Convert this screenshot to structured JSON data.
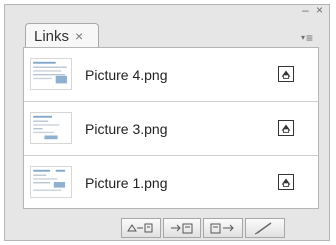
{
  "panel": {
    "tab": {
      "label": "Links",
      "close_glyph": "×"
    },
    "window_controls": {
      "minimize": "–",
      "close": "×"
    }
  },
  "links": [
    {
      "filename": "Picture 4.png",
      "thumb_icon": "screenshot-thumbnail-icon"
    },
    {
      "filename": "Picture 3.png",
      "thumb_icon": "screenshot-thumbnail-icon"
    },
    {
      "filename": "Picture 1.png",
      "thumb_icon": "screenshot-thumbnail-icon"
    }
  ],
  "toolbar": {
    "buttons": [
      {
        "name": "relink-button",
        "icon": "relink-icon"
      },
      {
        "name": "goto-link-button",
        "icon": "goto-link-icon"
      },
      {
        "name": "update-link-button",
        "icon": "update-link-icon"
      },
      {
        "name": "edit-original-button",
        "icon": "edit-original-icon"
      }
    ]
  },
  "colors": {
    "panel_bg": "#e6e6e6",
    "list_bg": "#ffffff",
    "border": "#b5b5b5",
    "text": "#222222"
  }
}
